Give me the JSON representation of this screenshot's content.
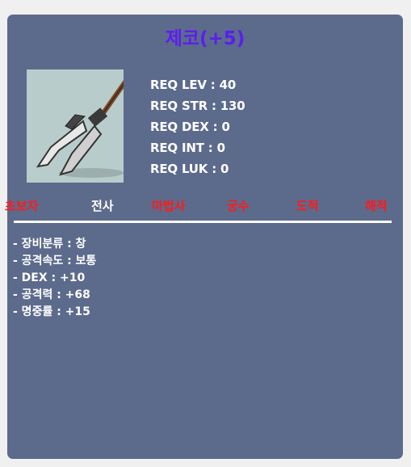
{
  "item": {
    "name": "제코(+5)",
    "icon": "halberd-spear-icon",
    "colors": {
      "name": "#5b1ef0",
      "panel": "#5c6a8c",
      "icon_bg": "#b8cccc"
    }
  },
  "requirements": [
    "REQ LEV : 40",
    "REQ STR : 130",
    "REQ DEX : 0",
    "REQ INT : 0",
    "REQ LUK : 0"
  ],
  "jobs": [
    {
      "label": "초보자",
      "color": "#ff1a1a"
    },
    {
      "label": "전사",
      "color": "#ffffff"
    },
    {
      "label": "마법사",
      "color": "#ff1a1a"
    },
    {
      "label": "궁수",
      "color": "#ff1a1a"
    },
    {
      "label": "도적",
      "color": "#ff1a1a"
    },
    {
      "label": "해적",
      "color": "#ff1a1a"
    }
  ],
  "stats": [
    "- 장비분류 : 창",
    "- 공격속도 : 보통",
    "- DEX : +10",
    "- 공격력 : +68",
    "- 명중률 : +15"
  ]
}
